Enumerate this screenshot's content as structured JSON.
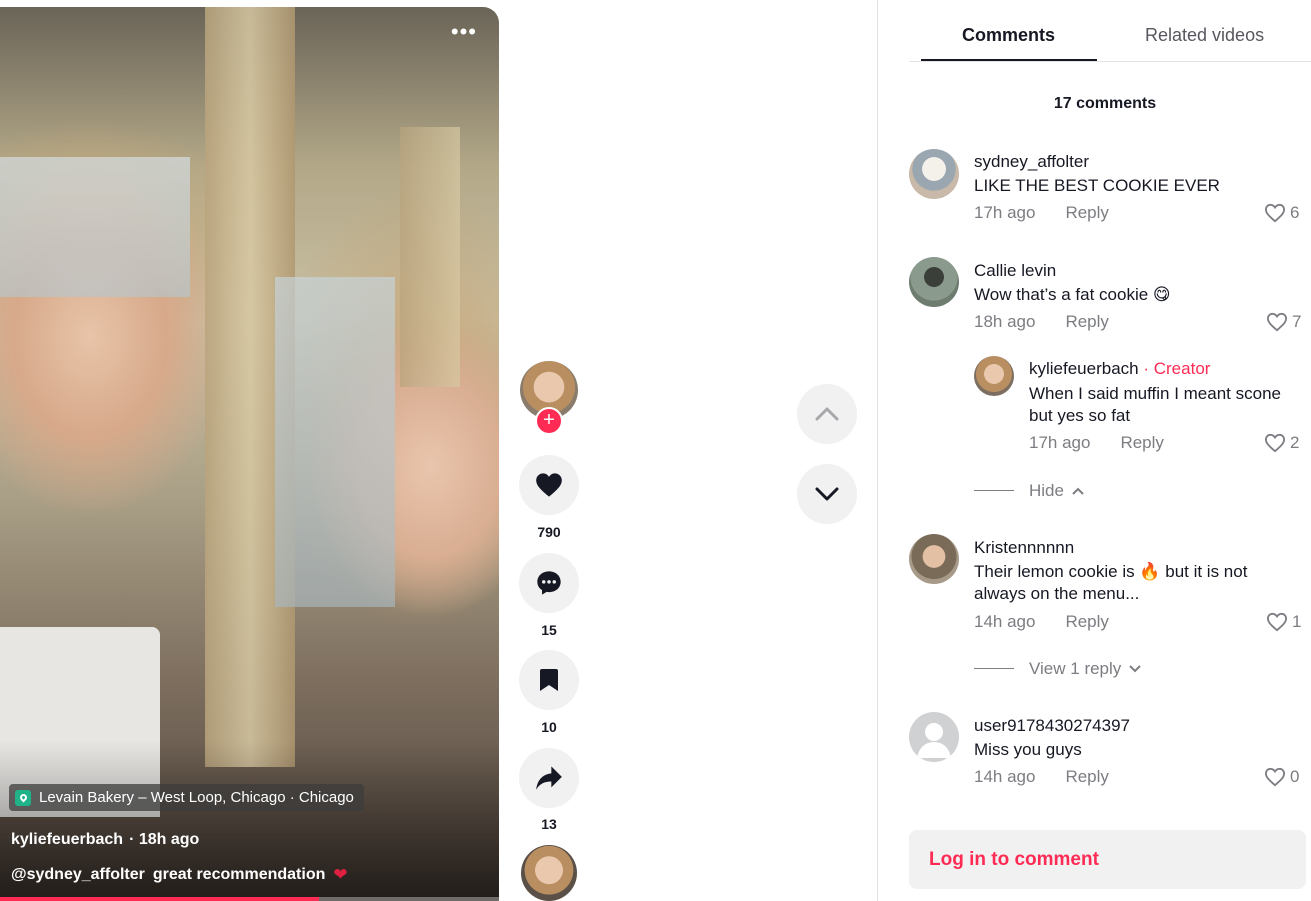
{
  "video": {
    "more_label": "•••",
    "location": "Levain Bakery – West Loop, Chicago · Chicago",
    "author": "kyliefeuerbach",
    "time": "· 18h ago",
    "caption_mention": "@sydney_affolter",
    "caption_text": "great recommendation",
    "caption_emoji": "❤",
    "progress": 0.64
  },
  "actions": {
    "follow_plus": "+",
    "likes": "790",
    "comments": "15",
    "saves": "10",
    "shares": "13"
  },
  "tabs": [
    {
      "label": "Comments",
      "active": true
    },
    {
      "label": "Related videos",
      "active": false
    }
  ],
  "comments_count": "17 comments",
  "comments": [
    {
      "user": "sydney_affolter",
      "text": "LIKE THE BEST COOKIE EVER",
      "time": "17h ago",
      "reply": "Reply",
      "likes": "6"
    },
    {
      "user": "Callie levin",
      "text": "Wow that’s a fat cookie 😋",
      "time": "18h ago",
      "reply": "Reply",
      "likes": "7",
      "replies": [
        {
          "user": "kyliefeuerbach",
          "badge": "· Creator",
          "text": "When I said muffin I meant scone but yes so fat",
          "time": "17h ago",
          "reply": "Reply",
          "likes": "2"
        }
      ],
      "thread_control": "Hide"
    },
    {
      "user": "Kristennnnnn",
      "text": "Their lemon cookie is 🔥 but it is not always on the menu...",
      "time": "14h ago",
      "reply": "Reply",
      "likes": "1",
      "thread_control": "View 1 reply"
    },
    {
      "user": "user9178430274397",
      "text": "Miss you guys",
      "time": "14h ago",
      "reply": "Reply",
      "likes": "0"
    }
  ],
  "login_label": "Log in to comment",
  "colors": {
    "accent": "#fe2c55",
    "secondary_text": "#7c7d82",
    "button_bg": "#f1f1f2"
  }
}
